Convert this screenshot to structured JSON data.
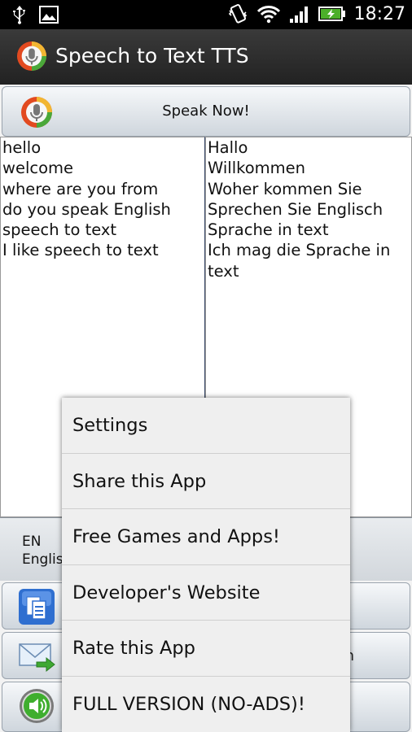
{
  "status_bar": {
    "time": "18:27",
    "icons": [
      "usb-icon",
      "image-icon",
      "vibrate-icon",
      "wifi-icon",
      "signal-icon",
      "battery-charging-icon"
    ]
  },
  "app_bar": {
    "title": "Speech to Text TTS",
    "icon": "microphone-app-icon"
  },
  "speak_button": {
    "label": "Speak Now!",
    "icon": "microphone-icon"
  },
  "source_pane": {
    "lines": [
      "hello",
      "welcome",
      "where are you from",
      "do you speak English",
      "speech to text",
      "I like speech to text"
    ]
  },
  "target_pane": {
    "lines": [
      "Hallo",
      "Willkommen",
      "Woher kommen Sie",
      "Sprechen Sie Englisch",
      "Sprache in text",
      "Ich mag die Sprache in",
      "text"
    ]
  },
  "language_bar": {
    "code": "EN",
    "name": "English"
  },
  "action_rows": [
    {
      "icon": "copy-icon",
      "peek": ""
    },
    {
      "icon": "email-forward-icon",
      "peek": "n"
    },
    {
      "icon": "speaker-icon",
      "peek": ""
    }
  ],
  "menu": {
    "items": [
      {
        "label": "Settings"
      },
      {
        "label": "Share this App"
      },
      {
        "label": "Free Games and Apps!"
      },
      {
        "label": "Developer's Website"
      },
      {
        "label": "Rate this App"
      },
      {
        "label": "FULL VERSION (NO-ADS)!"
      }
    ]
  },
  "colors": {
    "status_bar": "#000000",
    "title_bar": "#2b2b2b",
    "button_gradient_top": "#f6f8fa",
    "button_gradient_bottom": "#cfd6dd",
    "menu_background": "#efefef"
  }
}
